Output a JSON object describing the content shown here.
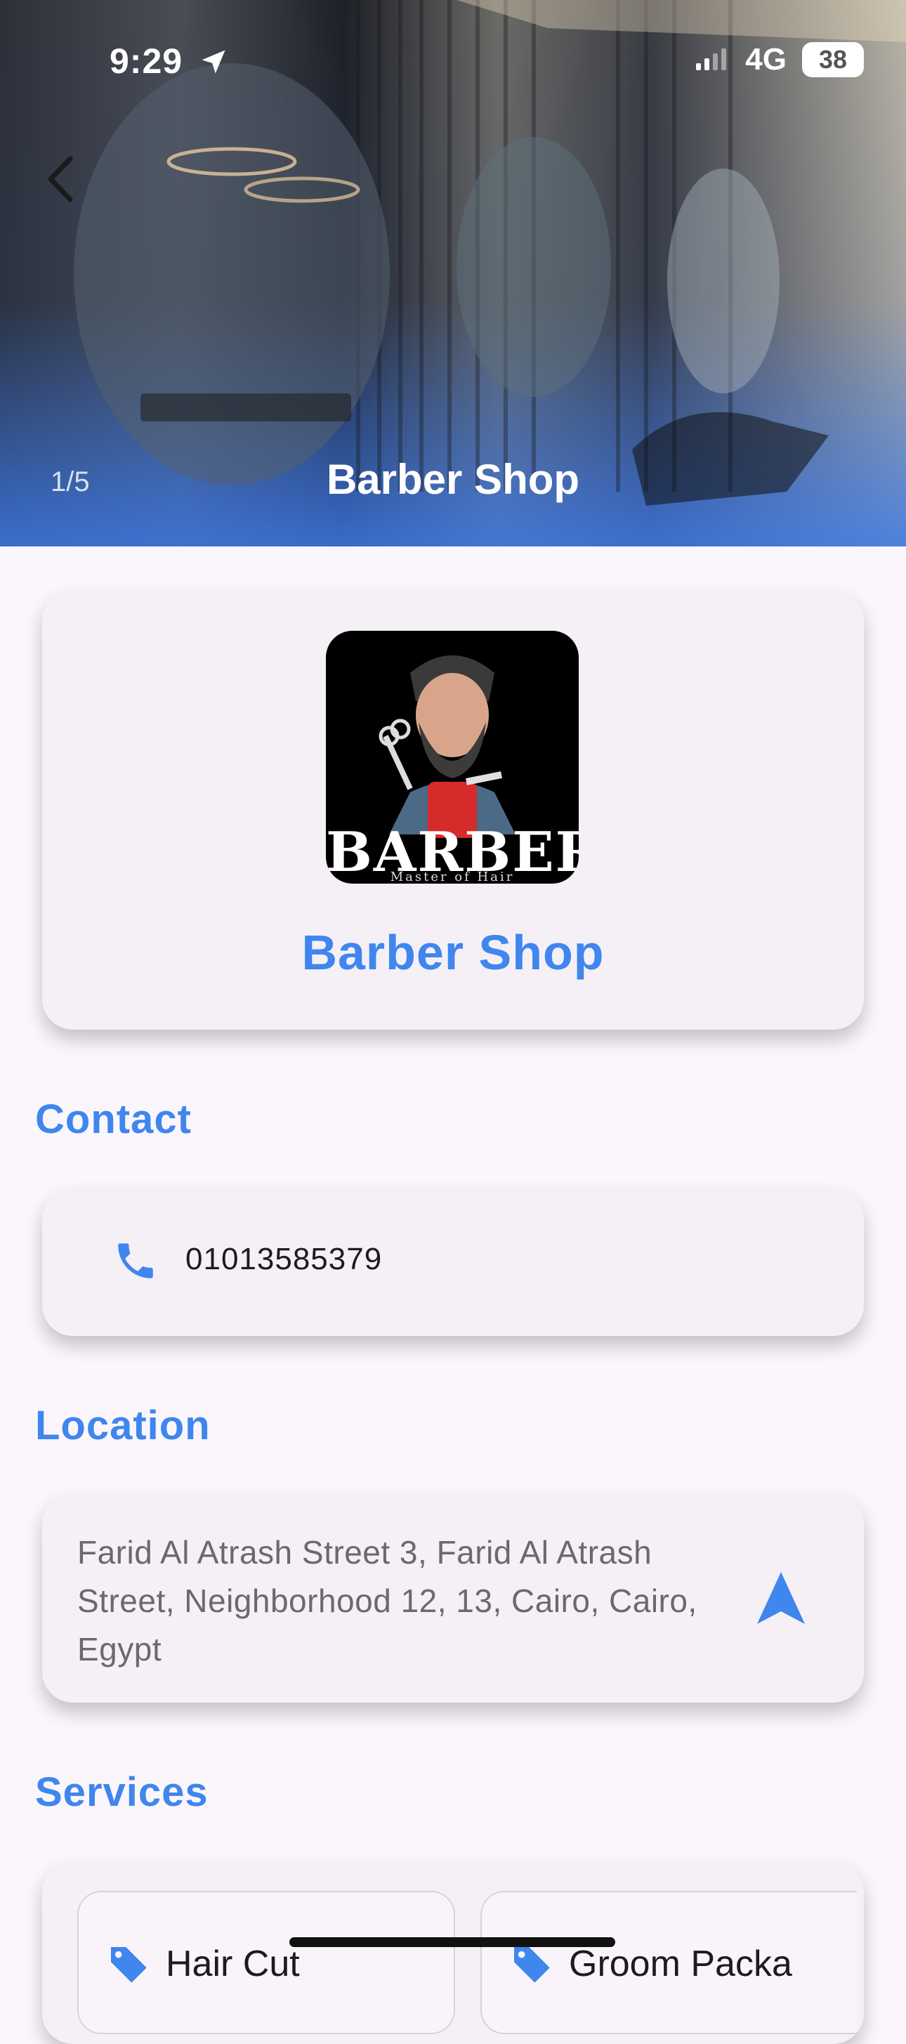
{
  "status_bar": {
    "time": "9:29",
    "network": "4G",
    "battery": "38"
  },
  "hero": {
    "counter": "1/5",
    "title": "Barber Shop"
  },
  "profile": {
    "logo_word": "BARBER",
    "logo_subtitle": "Master of Hair",
    "name": "Barber Shop"
  },
  "contact": {
    "heading": "Contact",
    "phone": "01013585379"
  },
  "location": {
    "heading": "Location",
    "address": "Farid Al Atrash Street 3, Farid Al Atrash Street, Neighborhood 12, 13, Cairo, Cairo, Egypt"
  },
  "services": {
    "heading": "Services",
    "items": [
      {
        "label": "Hair Cut"
      },
      {
        "label": "Groom Packa"
      }
    ]
  },
  "colors": {
    "accent": "#3f86ee",
    "background": "#fbf6fc",
    "card": "#f5f0f6"
  }
}
